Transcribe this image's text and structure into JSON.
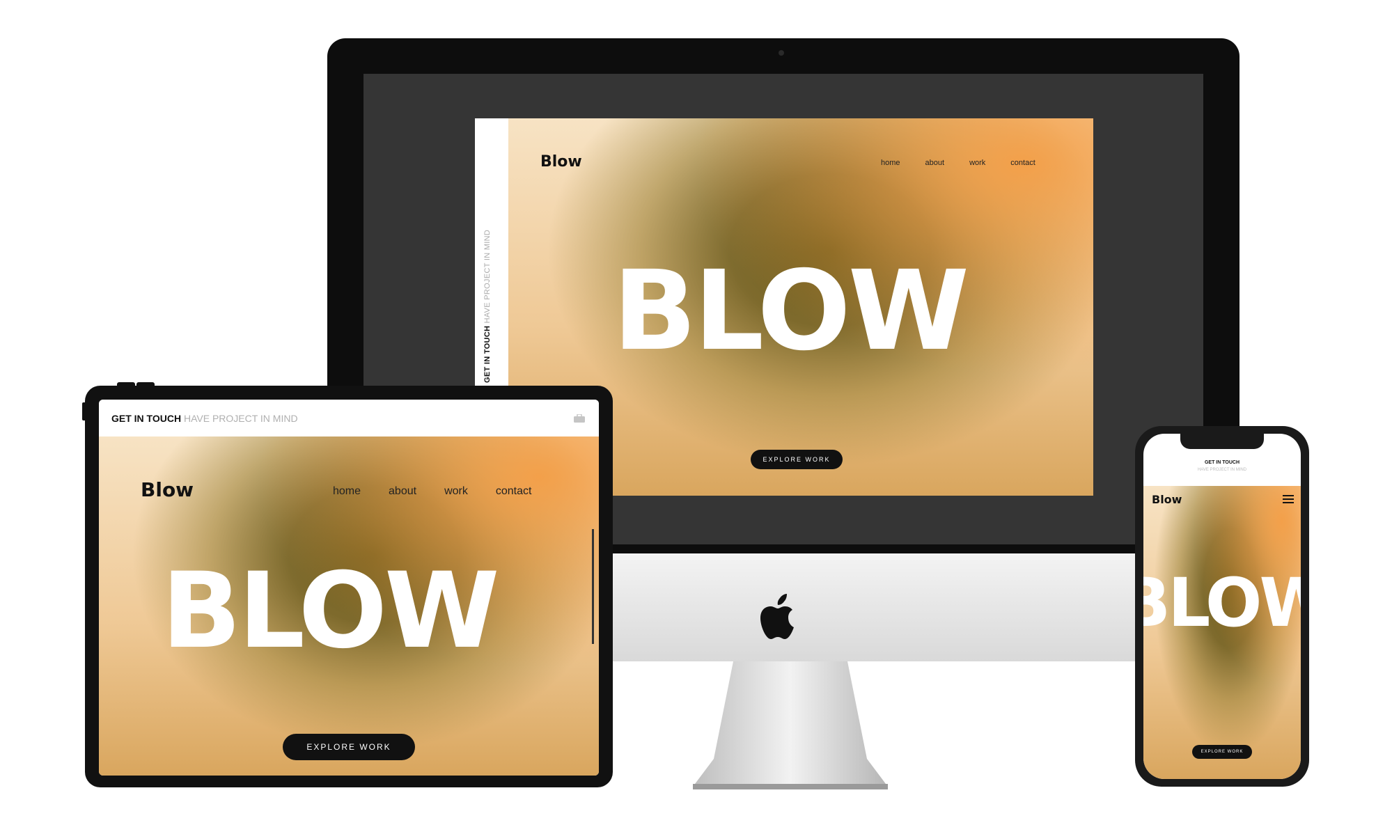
{
  "desktop": {
    "side_bold": "GET IN TOUCH",
    "side_light": " HAVE PROJECT IN MIND",
    "logo": "Blow",
    "nav": [
      "home",
      "about",
      "work",
      "contact"
    ],
    "hero_word": "BLOW",
    "cta": "EXPLORE WORK"
  },
  "tablet": {
    "top_bold": "GET IN TOUCH",
    "top_light": " HAVE PROJECT IN MIND",
    "logo": "Blow",
    "nav": [
      "home",
      "about",
      "work",
      "contact"
    ],
    "hero_word": "BLOW",
    "cta": "EXPLORE WORK",
    "icon": "briefcase-icon"
  },
  "phone": {
    "top_bold": "GET IN TOUCH",
    "top_light": "HAVE PROJECT IN MIND",
    "logo": "Blow",
    "hero_word": "BLOW",
    "cta": "EXPLORE WORK",
    "icon": "hamburger-menu-icon"
  },
  "colors": {
    "accent_orange": "#f3a04a",
    "smoke": "#6b5a1a",
    "cta_bg": "#111111"
  }
}
